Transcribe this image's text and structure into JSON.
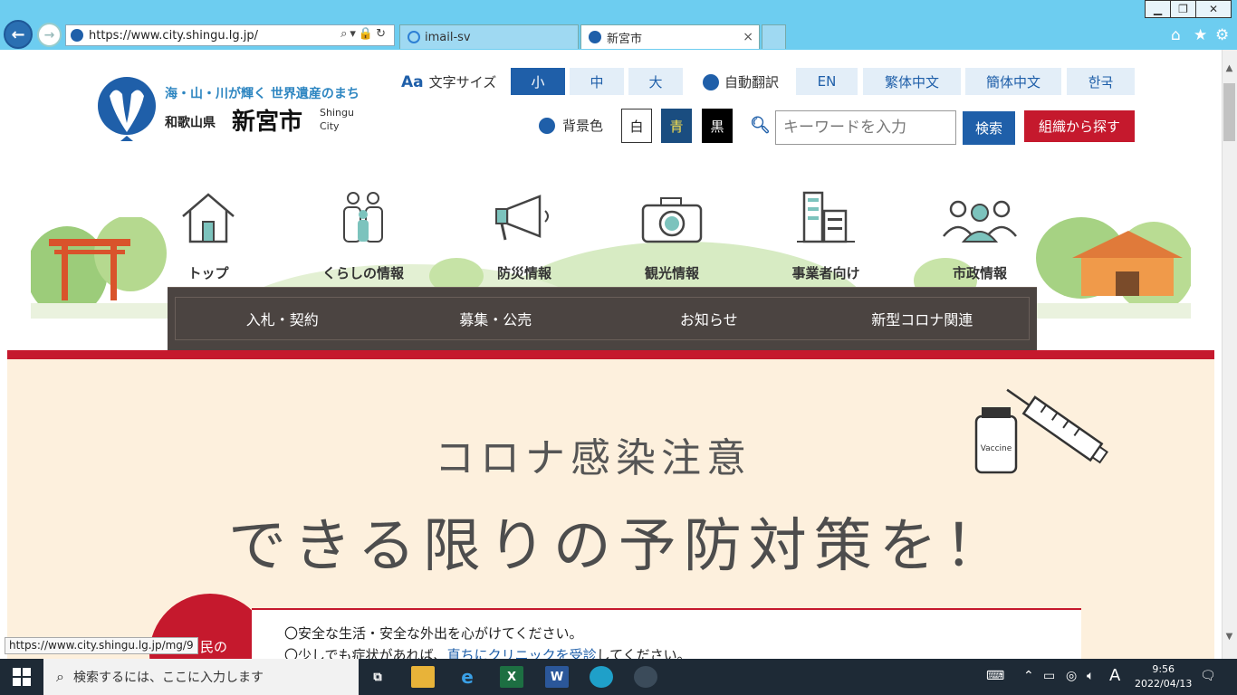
{
  "browser": {
    "url": "https://www.city.shingu.lg.jp/",
    "tabs": [
      {
        "label": "imail-sv"
      },
      {
        "label": "新宮市",
        "close": "×"
      }
    ],
    "status_url": "https://www.city.shingu.lg.jp/mg/9"
  },
  "header": {
    "tagline": "海・山・川が輝く 世界遺産のまち",
    "prefecture": "和歌山県",
    "city": "新宮市",
    "city_en_1": "Shingu",
    "city_en_2": "City",
    "font_size_label": "文字サイズ",
    "font_sizes": [
      "小",
      "中",
      "大"
    ],
    "translate_label": "自動翻訳",
    "languages": [
      "EN",
      "繁体中文",
      "簡体中文",
      "한국"
    ],
    "bg_color_label": "背景色",
    "bg_colors": [
      "白",
      "青",
      "黒"
    ],
    "search_placeholder": "キーワードを入力",
    "search_button": "検索",
    "org_button": "組織から探す"
  },
  "nav": {
    "items": [
      "トップ",
      "くらしの情報",
      "防災情報",
      "観光情報",
      "事業者向け",
      "市政情報"
    ],
    "sub_items": [
      "入札・契約",
      "募集・公売",
      "お知らせ",
      "新型コロナ関連"
    ]
  },
  "banner": {
    "title1": "コロナ感染注意",
    "title2": "できる限りの予防対策を！",
    "vaccine_label": "Vaccine",
    "circle_text": "民の",
    "line1": "〇安全な生活・安全な外出を心がけてください。",
    "line2_a": "〇少しでも症状があれば、",
    "line2_link": "直ちにクリニックを受診",
    "line2_b": "してください。"
  },
  "taskbar": {
    "search_placeholder": "検索するには、ここに入力します",
    "ime": "A",
    "time": "9:56",
    "date": "2022/04/13"
  },
  "colors": {
    "primary": "#1f5fa9",
    "accent": "#c5192d",
    "chrome": "#6dcdf0"
  }
}
